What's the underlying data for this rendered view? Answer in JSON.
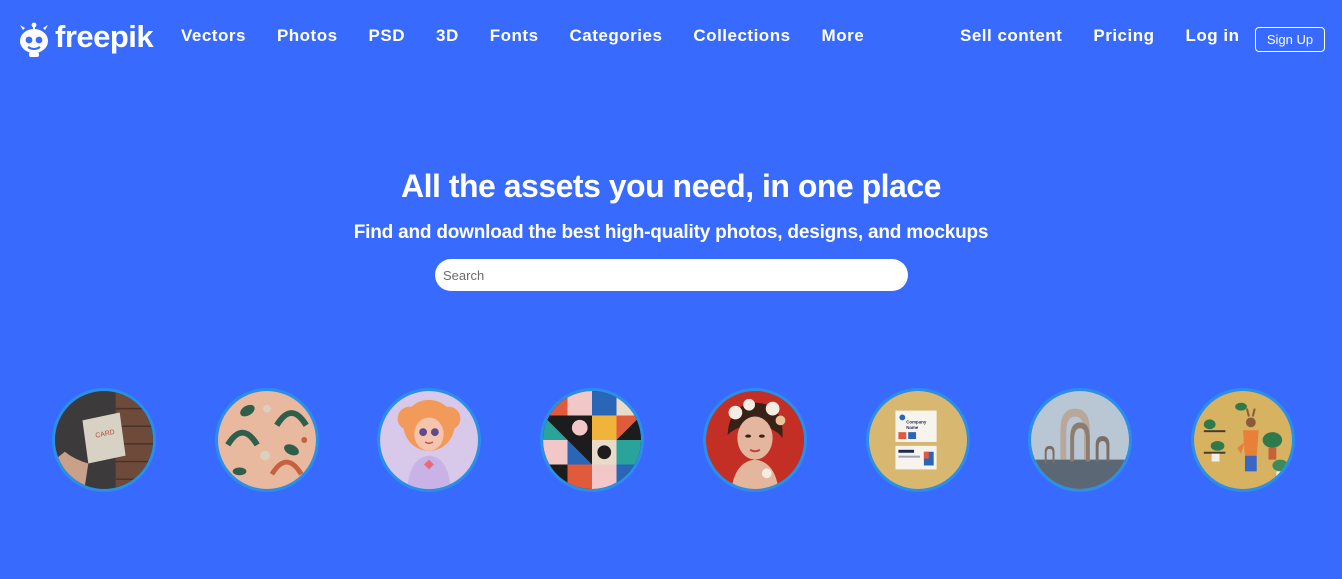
{
  "brand": {
    "name": "freepik"
  },
  "nav": {
    "items": [
      "Vectors",
      "Photos",
      "PSD",
      "3D",
      "Fonts",
      "Categories",
      "Collections",
      "More"
    ]
  },
  "account": {
    "sell": "Sell content",
    "pricing": "Pricing",
    "login": "Log in",
    "signup": "Sign Up"
  },
  "hero": {
    "title": "All the assets you need, in one place",
    "subtitle": "Find and download the best high-quality photos, designs, and mockups",
    "search_placeholder": "Search"
  },
  "colors": {
    "background": "#386bfd",
    "circle_border": "#2a8fe8"
  },
  "categories": [
    {
      "name": "mockup-card-photo"
    },
    {
      "name": "boho-pattern"
    },
    {
      "name": "character-illustration"
    },
    {
      "name": "geometric-pattern"
    },
    {
      "name": "portrait-photo"
    },
    {
      "name": "company-brochure-template"
    },
    {
      "name": "3d-render-arches"
    },
    {
      "name": "plants-illustration"
    }
  ]
}
